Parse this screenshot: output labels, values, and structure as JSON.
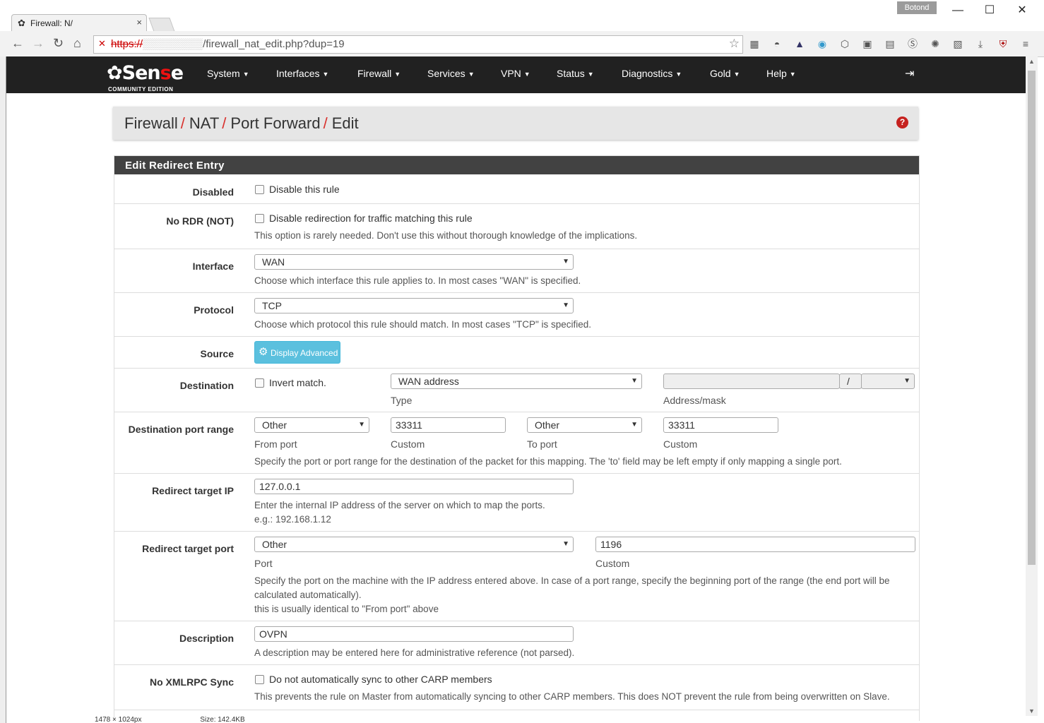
{
  "browser": {
    "tab_title": "Firewall: N/",
    "tab_close": "×",
    "user_badge": "Botond",
    "url_scheme": "https://",
    "url_rest": "/firewall_nat_edit.php?dup=19",
    "window_minimize": "—",
    "window_maximize": "☐",
    "window_close": "✕"
  },
  "navbar": {
    "logo_main": "Sen",
    "logo_s": "s",
    "logo_end": "e",
    "logo_sub": "COMMUNITY EDITION",
    "menus": [
      "System",
      "Interfaces",
      "Firewall",
      "Services",
      "VPN",
      "Status",
      "Diagnostics",
      "Gold",
      "Help"
    ]
  },
  "breadcrumb": {
    "items": [
      "Firewall",
      "NAT",
      "Port Forward",
      "Edit"
    ],
    "separator": "/"
  },
  "panel": {
    "title": "Edit Redirect Entry"
  },
  "form": {
    "disabled": {
      "label": "Disabled",
      "checkbox_text": "Disable this rule",
      "checked": false
    },
    "nordr": {
      "label": "No RDR (NOT)",
      "checkbox_text": "Disable redirection for traffic matching this rule",
      "help": "This option is rarely needed. Don't use this without thorough knowledge of the implications.",
      "checked": false
    },
    "interface": {
      "label": "Interface",
      "value": "WAN",
      "help": "Choose which interface this rule applies to. In most cases \"WAN\" is specified."
    },
    "protocol": {
      "label": "Protocol",
      "value": "TCP",
      "help": "Choose which protocol this rule should match. In most cases \"TCP\" is specified."
    },
    "source": {
      "label": "Source",
      "button": "Display Advanced"
    },
    "destination": {
      "label": "Destination",
      "invert_text": "Invert match.",
      "type_value": "WAN address",
      "type_label": "Type",
      "address_value": "",
      "mask_sep": "/",
      "address_label": "Address/mask"
    },
    "dest_port": {
      "label": "Destination port range",
      "from_value": "Other",
      "from_label": "From port",
      "from_custom": "33311",
      "from_custom_label": "Custom",
      "to_value": "Other",
      "to_label": "To port",
      "to_custom": "33311",
      "to_custom_label": "Custom",
      "help": "Specify the port or port range for the destination of the packet for this mapping. The 'to' field may be left empty if only mapping a single port."
    },
    "target_ip": {
      "label": "Redirect target IP",
      "value": "127.0.0.1",
      "help1": "Enter the internal IP address of the server on which to map the ports.",
      "help2": "e.g.: 192.168.1.12"
    },
    "target_port": {
      "label": "Redirect target port",
      "port_value": "Other",
      "port_label": "Port",
      "custom_value": "1196",
      "custom_label": "Custom",
      "help1": "Specify the port on the machine with the IP address entered above. In case of a port range, specify the beginning port of the range (the end port will be",
      "help2": "calculated automatically).",
      "help3": "this is usually identical to \"From port\" above"
    },
    "description": {
      "label": "Description",
      "value": "OVPN",
      "help": "A description may be entered here for administrative reference (not parsed)."
    },
    "noxmlrpc": {
      "label": "No XMLRPC Sync",
      "checkbox_text": "Do not automatically sync to other CARP members",
      "help": "This prevents the rule on Master from automatically syncing to other CARP members. This does NOT prevent the rule from being overwritten on Slave.",
      "checked": false
    }
  },
  "statusbar": {
    "dimensions": "1478 × 1024px",
    "size": "Size: 142.4KB"
  },
  "colors": {
    "navbar_bg": "#212121",
    "accent_red": "#d9322e",
    "panel_head": "#424242",
    "btn_info": "#5bc0de"
  }
}
